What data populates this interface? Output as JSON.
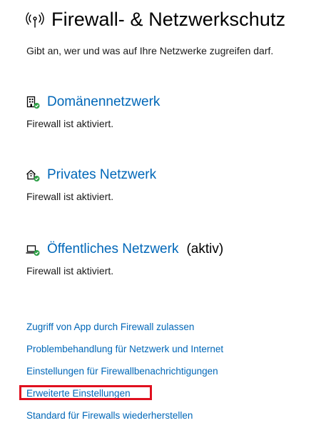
{
  "page": {
    "title": "Firewall- & Netzwerkschutz",
    "subtitle": "Gibt an, wer und was auf Ihre Netzwerke zugreifen darf."
  },
  "networks": [
    {
      "name": "Domänennetzwerk",
      "suffix": "",
      "status": "Firewall ist aktiviert.",
      "icon": "domain-network-shield-icon"
    },
    {
      "name": "Privates Netzwerk",
      "suffix": "",
      "status": "Firewall ist aktiviert.",
      "icon": "private-network-shield-icon"
    },
    {
      "name": "Öffentliches Netzwerk",
      "suffix": "(aktiv)",
      "status": "Firewall ist aktiviert.",
      "icon": "public-network-shield-icon"
    }
  ],
  "links": [
    "Zugriff von App durch Firewall zulassen",
    "Problembehandlung für Netzwerk und Internet",
    "Einstellungen für Firewallbenachrichtigungen",
    "Erweiterte Einstellungen",
    "Standard für Firewalls wiederherstellen"
  ],
  "colors": {
    "link": "#0067b8",
    "status_ok": "#2c9f45",
    "highlight": "#e0101f"
  }
}
